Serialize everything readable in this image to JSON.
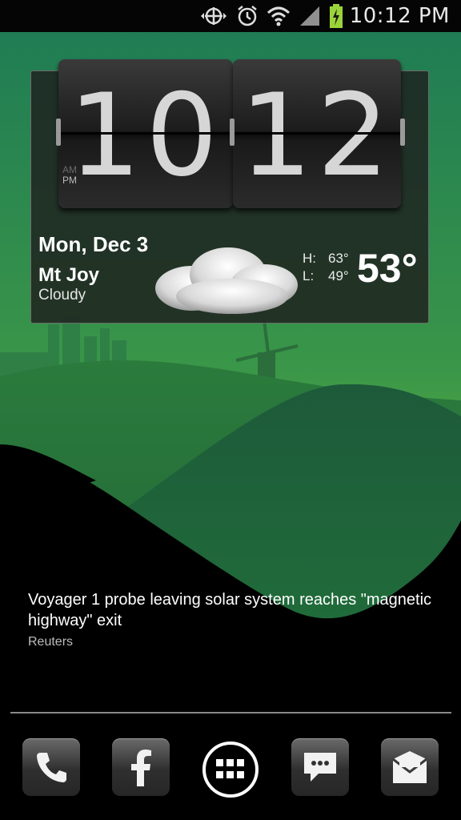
{
  "status_bar": {
    "time": "10:12 PM",
    "icons": [
      "sync-icon",
      "alarm-icon",
      "wifi-icon",
      "signal-icon",
      "battery-charging-icon"
    ]
  },
  "clock_widget": {
    "hours": "10",
    "minutes": "12",
    "am_label": "AM",
    "pm_label": "PM"
  },
  "weather": {
    "date": "Mon, Dec 3",
    "city": "Mt Joy",
    "condition": "Cloudy",
    "high_label": "H:",
    "high": "63°",
    "low_label": "L:",
    "low": "49°",
    "temperature": "53°",
    "icon": "cloud-icon"
  },
  "news": {
    "headline": "Voyager 1 probe leaving solar system reaches \"magnetic highway\" exit",
    "source": "Reuters"
  },
  "dock": {
    "items": [
      "phone-icon",
      "facebook-icon",
      "apps-grid-icon",
      "messaging-icon",
      "email-icon"
    ]
  },
  "colors": {
    "sky_top": "#1f7a52",
    "sky_bottom": "#4fa83f",
    "hill_dark": "#1b5a32",
    "foreground": "#000000"
  }
}
